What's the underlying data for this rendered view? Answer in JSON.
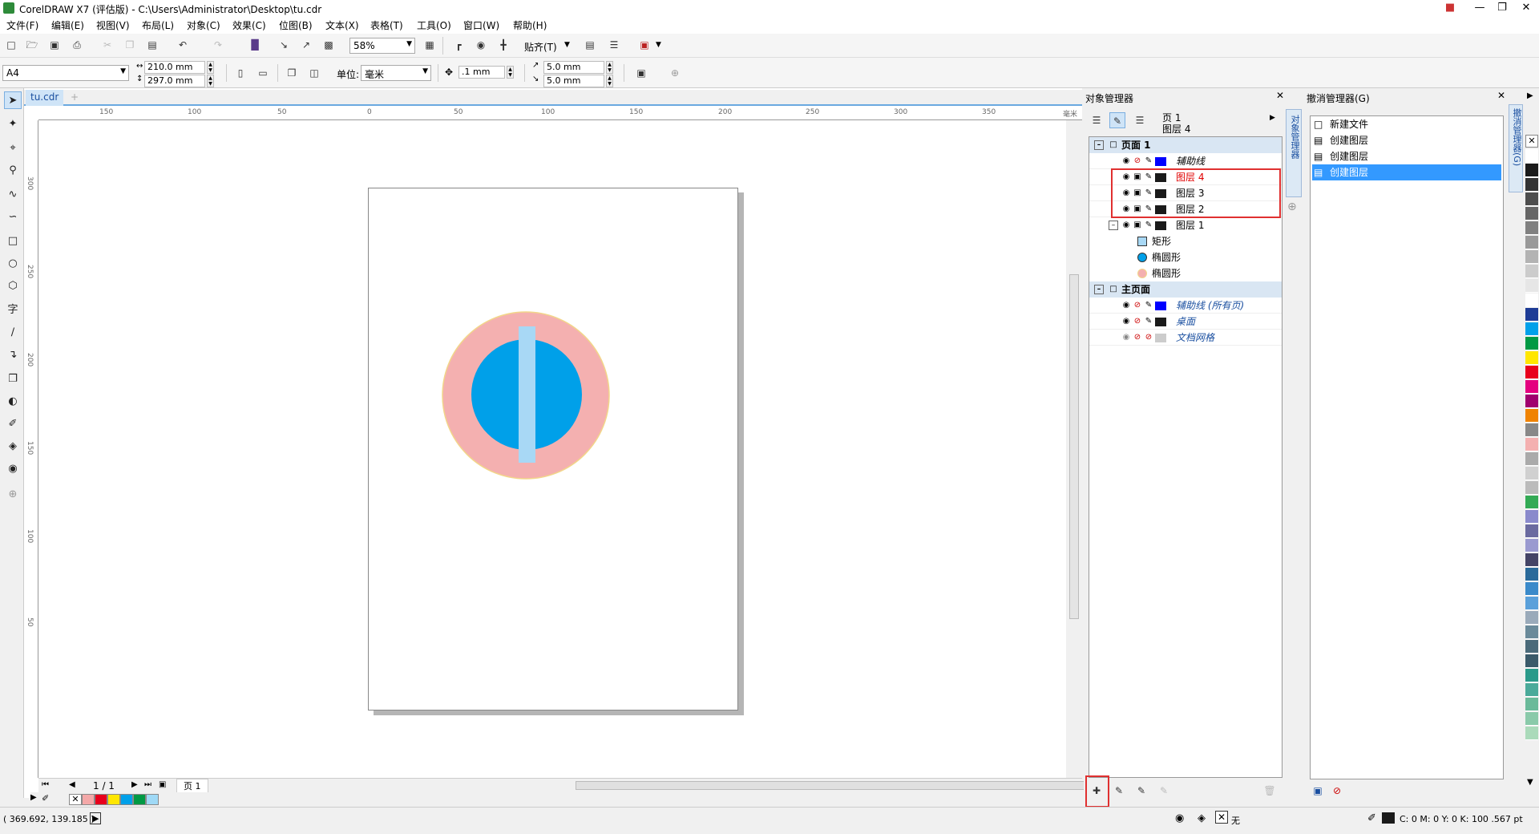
{
  "app": {
    "title": "CorelDRAW X7 (评估版) - C:\\Users\\Administrator\\Desktop\\tu.cdr"
  },
  "menu": [
    "文件(F)",
    "编辑(E)",
    "视图(V)",
    "布局(L)",
    "对象(C)",
    "效果(C)",
    "位图(B)",
    "文本(X)",
    "表格(T)",
    "工具(O)",
    "窗口(W)",
    "帮助(H)"
  ],
  "stdbar": {
    "zoom": "58%",
    "snap": "贴齐(T)"
  },
  "propbar": {
    "paper": "A4",
    "width": "210.0 mm",
    "height": "297.0 mm",
    "units_label": "单位:",
    "units": "毫米",
    "nudge": ".1 mm",
    "dup_x": "5.0 mm",
    "dup_y": "5.0 mm"
  },
  "doc": {
    "tab": "tu.cdr",
    "hruler": [
      "150",
      "100",
      "50",
      "0",
      "50",
      "100",
      "150",
      "200",
      "250",
      "300",
      "350"
    ],
    "vruler": [
      "300",
      "250",
      "200",
      "150",
      "100",
      "50"
    ],
    "unit_label": "毫米",
    "page_nav": "1 / 1",
    "page_tab": "页 1"
  },
  "palette_bottom": [
    "#f4a8a8",
    "#e8001c",
    "#ffe600",
    "#00a0e9",
    "#009944",
    "#9fd9f6"
  ],
  "status": {
    "coords": "( 369.692, 139.185 )",
    "fill_none": "无",
    "outline_info": "C: 0 M: 0 Y: 0 K: 100  .567 pt"
  },
  "objmgr": {
    "title": "对象管理器",
    "current_page": "页 1",
    "current_layer": "图层 4",
    "vtab": "对象管理器",
    "rows": [
      {
        "label": "页面 1",
        "type": "page"
      },
      {
        "label": "辅助线",
        "type": "layer",
        "color": "#0000ff",
        "italic": true
      },
      {
        "label": "图层 4",
        "type": "layer",
        "color": "#1a1a1a",
        "active": true
      },
      {
        "label": "图层 3",
        "type": "layer",
        "color": "#1a1a1a"
      },
      {
        "label": "图层 2",
        "type": "layer",
        "color": "#1a1a1a"
      },
      {
        "label": "图层 1",
        "type": "layer",
        "color": "#1a1a1a"
      },
      {
        "label": "矩形",
        "type": "obj",
        "icon": "rect"
      },
      {
        "label": "椭圆形",
        "type": "obj",
        "icon": "ellipse-blue"
      },
      {
        "label": "椭圆形",
        "type": "obj",
        "icon": "ellipse-pink"
      },
      {
        "label": "主页面",
        "type": "page"
      },
      {
        "label": "辅助线 (所有页)",
        "type": "layer",
        "color": "#0000ff",
        "italic": true
      },
      {
        "label": "桌面",
        "type": "layer",
        "color": "#1a1a1a",
        "italic": true
      },
      {
        "label": "文档网格",
        "type": "layer",
        "color": "#cccccc",
        "italic": true
      }
    ]
  },
  "undomgr": {
    "title": "撤消管理器(G)",
    "vtab": "撤消管理器(G)",
    "items": [
      "新建文件",
      "创建图层",
      "创建图层",
      "创建图层"
    ],
    "selected": 3
  },
  "colors": {
    "canvas_pink": "#f4b0b0",
    "canvas_blue": "#00a0e9",
    "canvas_lightblue": "#a8d8f5",
    "highlight": "#e03030",
    "selection": "#3399ff"
  },
  "colorcol": [
    "#ffffff",
    "#1a1a1a",
    "#333333",
    "#4d4d4d",
    "#666666",
    "#808080",
    "#999999",
    "#b3b3b3",
    "#cccccc",
    "#e6e6e6",
    "#ffffff",
    "#1e3c96",
    "#00a0e9",
    "#009944",
    "#ffe600",
    "#e8001c",
    "#e4007f",
    "#a0006e",
    "#f08300",
    "#888888",
    "#f4b0b0",
    "#aaaaaa",
    "#d0d0d0",
    "#bbbbbb",
    "#33aa55",
    "#8a8acc",
    "#6a6aa0",
    "#9a9ad0",
    "#444466",
    "#2a6a9a",
    "#3a8aca",
    "#5aa0da",
    "#9aaaba",
    "#6a8a9a",
    "#4a6a7a",
    "#3a5a6a",
    "#2a9a8a",
    "#4aaa9a",
    "#6aba9a",
    "#8acaaa",
    "#aadaba"
  ]
}
